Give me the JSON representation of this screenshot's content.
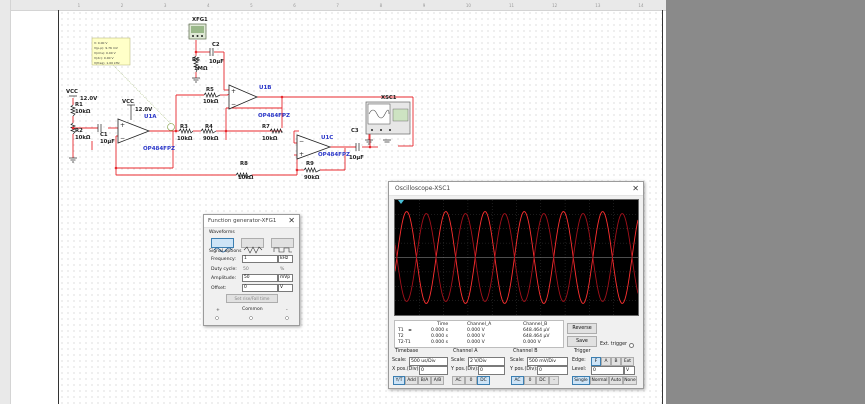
{
  "ruler": {
    "numbers": [
      "1",
      "2",
      "3",
      "4",
      "5",
      "6",
      "7",
      "8",
      "9",
      "10",
      "11",
      "12",
      "13",
      "14"
    ]
  },
  "schematic": {
    "xfg_label": "XFG1",
    "xsc_label": "XSC1",
    "probe_text": [
      "V: 0.00 V",
      "V(p-p): 9.76 mV",
      "V(rms): 0.00 V",
      "V(dc): 0.00 V",
      "V(freq): 1.00 kHz"
    ],
    "vcc_left": "VCC",
    "vcc_left_volt": "12.0V",
    "vcc_mid": "VCC",
    "vcc_mid_volt": "12.0V",
    "r1": "R1",
    "r1_val": "10kΩ",
    "r2": "R2",
    "r2_val": "10kΩ",
    "c1": "C1",
    "c1_val": "10µF",
    "c2": "C2",
    "c2_val": "10µF",
    "c3": "C3",
    "c3_val": "10µF",
    "r3": "R3",
    "r3_val": "10kΩ",
    "r4": "R4",
    "r4_val": "90kΩ",
    "r5": "R5",
    "r5_val": "10kΩ",
    "r6": "R6",
    "r6_val": "1MΩ",
    "r7": "R7",
    "r7_val": "10kΩ",
    "r8": "R8",
    "r8_val": "10kΩ",
    "r9": "R9",
    "r9_val": "90kΩ",
    "u1a": "U1A",
    "u1a_part": "OP484FPZ",
    "u1b": "U1B",
    "u1b_part": "OP484FPZ",
    "u1c": "U1C",
    "u1c_part": "OP484FPZ"
  },
  "oscilloscope": {
    "title": "Oscilloscope-XSC1",
    "close": "✕",
    "table": {
      "headers": [
        "Time",
        "Channel_A",
        "Channel_B"
      ],
      "rows": [
        {
          "label": "T1",
          "time": "0.000 s",
          "a": "0.000 V",
          "b": "648.464 µV"
        },
        {
          "label": "T2",
          "time": "0.000 s",
          "a": "0.000 V",
          "b": "648.464 µV"
        },
        {
          "label": "T2-T1",
          "time": "0.000 s",
          "a": "0.000 V",
          "b": "0.000 V"
        }
      ]
    },
    "reverse": "Reverse",
    "save": "Save",
    "ext_trigger": "Ext. trigger",
    "timebase": {
      "title": "Timebase",
      "scale_label": "Scale:",
      "scale": "500 us/Div",
      "xpos_label": "X pos.(Div):",
      "xpos": "0",
      "modes": [
        "Y/T",
        "Add",
        "B/A",
        "A/B"
      ]
    },
    "channel_a": {
      "title": "Channel A",
      "scale_label": "Scale:",
      "scale": "2  V/Div",
      "ypos_label": "Y pos.(Div):",
      "ypos": "0",
      "modes": [
        "AC",
        "0",
        "DC"
      ]
    },
    "channel_b": {
      "title": "Channel B",
      "scale_label": "Scale:",
      "scale": "500 mV/Div",
      "ypos_label": "Y pos.(Div):",
      "ypos": "0",
      "modes": [
        "AC",
        "0",
        "DC",
        "-"
      ]
    },
    "trigger": {
      "title": "Trigger",
      "edge_label": "Edge:",
      "edges": [
        "F",
        "A",
        "B",
        "Ext"
      ],
      "level_label": "Level:",
      "level": "0",
      "level_unit": "V",
      "modes": [
        "Single",
        "Normal",
        "Auto",
        "None"
      ]
    }
  },
  "function_generator": {
    "title": "Function generator-XFG1",
    "close": "✕",
    "waveforms_label": "Waveforms",
    "signal_options_label": "Signal options",
    "frequency_label": "Frequency:",
    "frequency": "1",
    "frequency_unit": "kHz",
    "duty_label": "Duty cycle:",
    "duty": "50",
    "duty_unit": "%",
    "amplitude_label": "Amplitude:",
    "amplitude": "50",
    "amplitude_unit": "mVp",
    "offset_label": "Offset:",
    "offset": "0",
    "offset_unit": "V",
    "set_button": "Set rise/Fall time",
    "plus": "+",
    "common": "Common",
    "minus": "-"
  },
  "colors": {
    "wire": "#e8282e",
    "trace_a": "#ff3030",
    "trace_b": "#a3101a",
    "accent": "#2a36c8"
  }
}
